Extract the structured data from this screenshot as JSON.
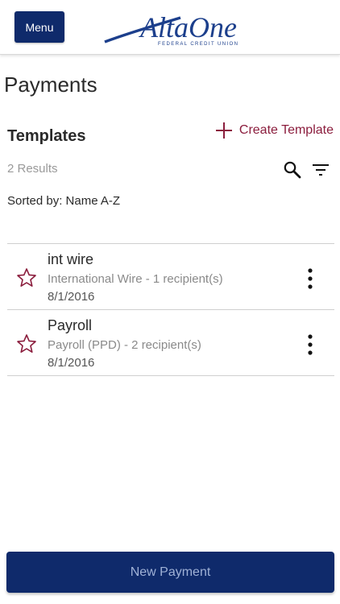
{
  "header": {
    "menu_label": "Menu",
    "logo": {
      "name": "AltaOne",
      "tagline": "FEDERAL CREDIT UNION"
    }
  },
  "page": {
    "title": "Payments",
    "section_title": "Templates",
    "create_label": "Create Template",
    "results_text": "2 Results",
    "sorted_text": "Sorted by: Name A-Z"
  },
  "templates": [
    {
      "name": "int wire",
      "description": "International Wire - 1 recipient(s)",
      "date": "8/1/2016"
    },
    {
      "name": "Payroll",
      "description": "Payroll (PPD) - 2 recipient(s)",
      "date": "8/1/2016"
    }
  ],
  "footer": {
    "button_label": "New Payment"
  },
  "icons": {
    "plus": "plus-icon",
    "search": "search-icon",
    "filter": "filter-icon",
    "star": "star-outline-icon",
    "more": "more-vertical-icon"
  },
  "colors": {
    "brand_navy": "#0f2a6b",
    "accent_maroon": "#8b1d3d",
    "muted_text": "#9a9a9a"
  }
}
